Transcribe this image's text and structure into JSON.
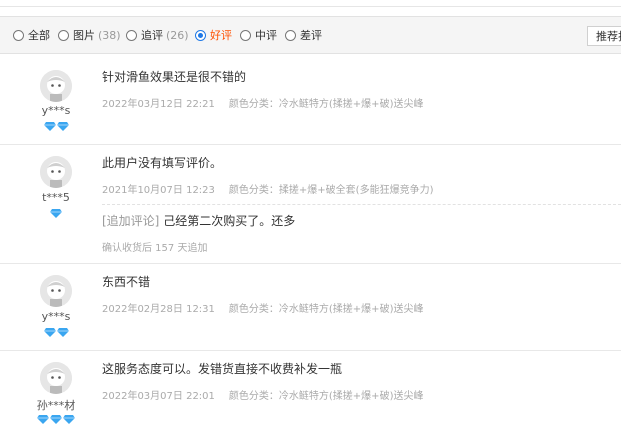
{
  "filters": [
    {
      "label": "全部",
      "count": "",
      "checked": false
    },
    {
      "label": "图片",
      "count": "(38)",
      "checked": false
    },
    {
      "label": "追评",
      "count": "(26)",
      "checked": false
    },
    {
      "label": "好评",
      "count": "",
      "checked": true
    },
    {
      "label": "中评",
      "count": "",
      "checked": false
    },
    {
      "label": "差评",
      "count": "",
      "checked": false
    }
  ],
  "sort_label": "推荐排序",
  "colors": {
    "accent": "#ff5000",
    "radio": "#1e78e6",
    "badge": "#3aa6f0",
    "meta": "#aaaaaa"
  },
  "reviews": [
    {
      "user": "y***s",
      "badge_count": 2,
      "content": "针对滑鱼效果还是很不错的",
      "date": "2022年03月12日 22:21",
      "sku": "颜色分类：冷水鲢特方(揉搓+爆+破)送尖峰"
    },
    {
      "user": "t***5",
      "badge_count": 1,
      "content": "此用户没有填写评价。",
      "date": "2021年10月07日 12:23",
      "sku": "颜色分类：揉搓+爆+破全套(多能狂爆竞争力)",
      "append_tag": "[追加评论]",
      "append_content": "己经第二次购买了。还多",
      "append_note": "确认收货后 157 天追加"
    },
    {
      "user": "y***s",
      "badge_count": 2,
      "content": "东西不错",
      "date": "2022年02月28日 12:31",
      "sku": "颜色分类：冷水鲢特方(揉搓+爆+破)送尖峰"
    },
    {
      "user": "孙***材",
      "badge_count": 3,
      "content": "这服务态度可以。发错货直接不收费补发一瓶",
      "date": "2022年03月07日 22:01",
      "sku": "颜色分类：冷水鲢特方(揉搓+爆+破)送尖峰"
    }
  ]
}
